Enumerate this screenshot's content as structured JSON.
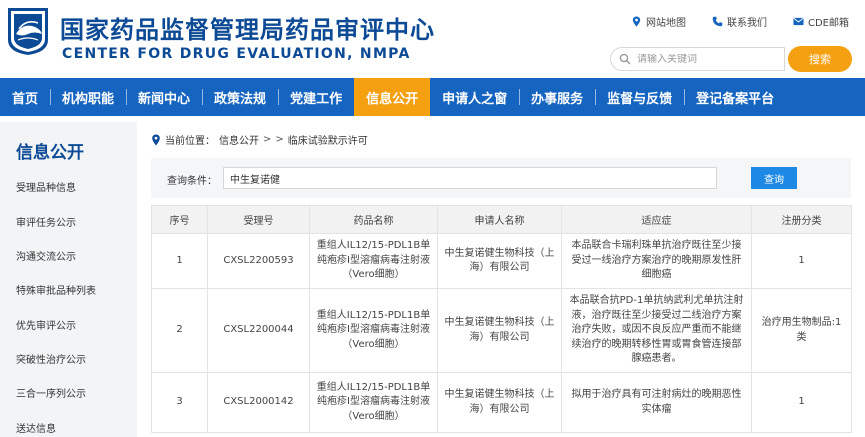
{
  "header": {
    "title_cn": "国家药品监督管理局药品审评中心",
    "title_en": "CENTER FOR DRUG EVALUATION, NMPA",
    "links": [
      {
        "label": "网站地图",
        "icon": "map-pin-icon"
      },
      {
        "label": "联系我们",
        "icon": "phone-icon"
      },
      {
        "label": "CDE邮箱",
        "icon": "mail-icon"
      }
    ],
    "search_placeholder": "请输入关键词",
    "search_button": "搜索"
  },
  "nav": {
    "items": [
      "首页",
      "机构职能",
      "新闻中心",
      "政策法规",
      "党建工作",
      "信息公开",
      "申请人之窗",
      "办事服务",
      "监督与反馈",
      "登记备案平台"
    ],
    "active_index": 5
  },
  "sidebar": {
    "title": "信息公开",
    "items": [
      "受理品种信息",
      "审评任务公示",
      "沟通交流公示",
      "特殊审批品种列表",
      "优先审评公示",
      "突破性治疗公示",
      "三合一序列公示",
      "送达信息"
    ]
  },
  "breadcrumb": {
    "prefix": "当前位置：",
    "items": [
      "信息公开",
      ">",
      ">",
      "临床试验默示许可"
    ]
  },
  "query": {
    "label": "查询条件：",
    "value": "中生复诺健",
    "button": "查询"
  },
  "table": {
    "headers": [
      "序号",
      "受理号",
      "药品名称",
      "申请人名称",
      "适应症",
      "注册分类"
    ],
    "rows": [
      {
        "no": "1",
        "acceptance_no": "CXSL2200593",
        "drug_name": "重组人IL12/15-PDL1B单纯疱疹Ⅰ型溶瘤病毒注射液（Vero细胞）",
        "applicant": "中生复诺健生物科技（上海）有限公司",
        "indication": "本品联合卡瑞利珠单抗治疗既往至少接受过一线治疗方案治疗的晚期原发性肝细胞癌",
        "category": "1"
      },
      {
        "no": "2",
        "acceptance_no": "CXSL2200044",
        "drug_name": "重组人IL12/15-PDL1B单纯疱疹Ⅰ型溶瘤病毒注射液（Vero细胞）",
        "applicant": "中生复诺健生物科技（上海）有限公司",
        "indication": "本品联合抗PD-1单抗纳武利尤单抗注射液，治疗既往至少接受过二线治疗方案治疗失败，或因不良反应严重而不能继续治疗的晚期转移性胃或胃食管连接部腺癌患者。",
        "category": "治疗用生物制品:1类"
      },
      {
        "no": "3",
        "acceptance_no": "CXSL2000142",
        "drug_name": "重组人IL12/15-PDL1B单纯疱疹I型溶瘤病毒注射液（Vero细胞）",
        "applicant": "中生复诺健生物科技（上海）有限公司",
        "indication": "拟用于治疗具有可注射病灶的晚期恶性实体瘤",
        "category": "1"
      }
    ]
  },
  "colors": {
    "brand_blue": "#0c4a95",
    "nav_blue": "#1565c0",
    "accent_orange": "#f5a011",
    "query_blue": "#1e88e5"
  }
}
